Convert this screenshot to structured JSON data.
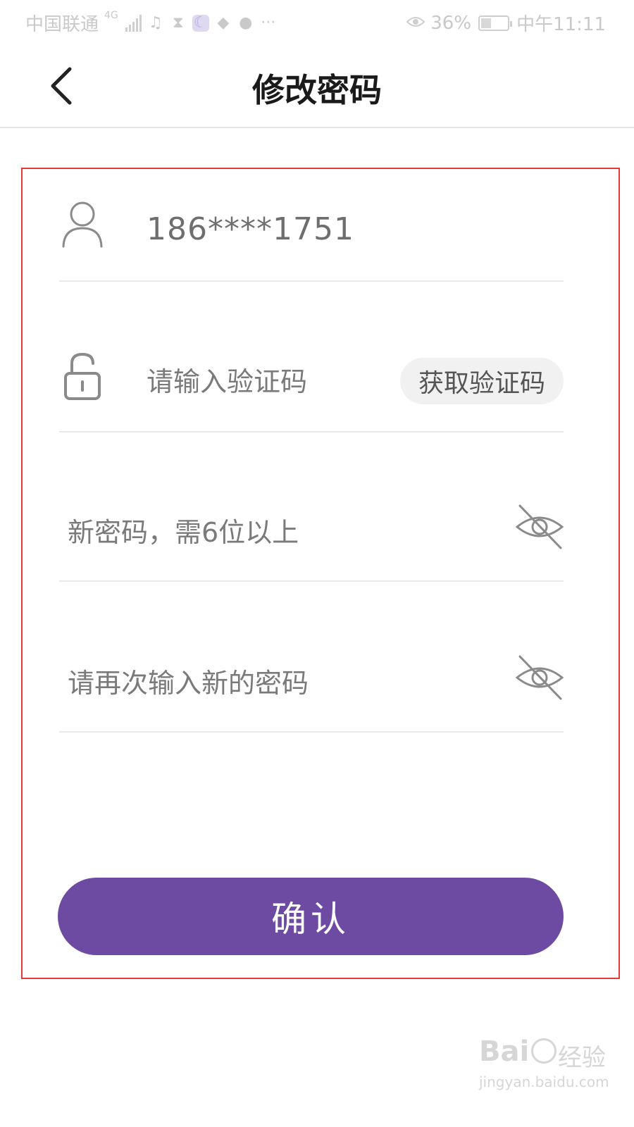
{
  "status_bar": {
    "carrier": "中国联通",
    "network": "4G",
    "icons": [
      "music-icon",
      "hourglass-icon",
      "moon-app-icon",
      "game-app-icon",
      "location-icon",
      "more-dots-icon"
    ],
    "eye_icon": "eye-icon",
    "battery": "36%",
    "time": "中午11:11"
  },
  "nav": {
    "back_icon": "chevron-left-icon",
    "title": "修改密码"
  },
  "form": {
    "phone": {
      "icon": "user-icon",
      "value": "186****1751"
    },
    "code": {
      "icon": "lock-icon",
      "placeholder": "请输入验证码",
      "button": "获取验证码"
    },
    "new_password": {
      "placeholder": "新密码，需6位以上",
      "toggle_icon": "eye-off-icon"
    },
    "confirm_password": {
      "placeholder": "请再次输入新的密码",
      "toggle_icon": "eye-off-icon"
    }
  },
  "confirm_button": "确认",
  "watermark": {
    "logo": "Bai",
    "brand": "经验",
    "url": "jingyan.baidu.com"
  },
  "colors": {
    "accent": "#6e4ba2",
    "highlight_frame": "#e03a3a",
    "divider": "#e8e8e8",
    "placeholder": "#7a7a7a"
  }
}
